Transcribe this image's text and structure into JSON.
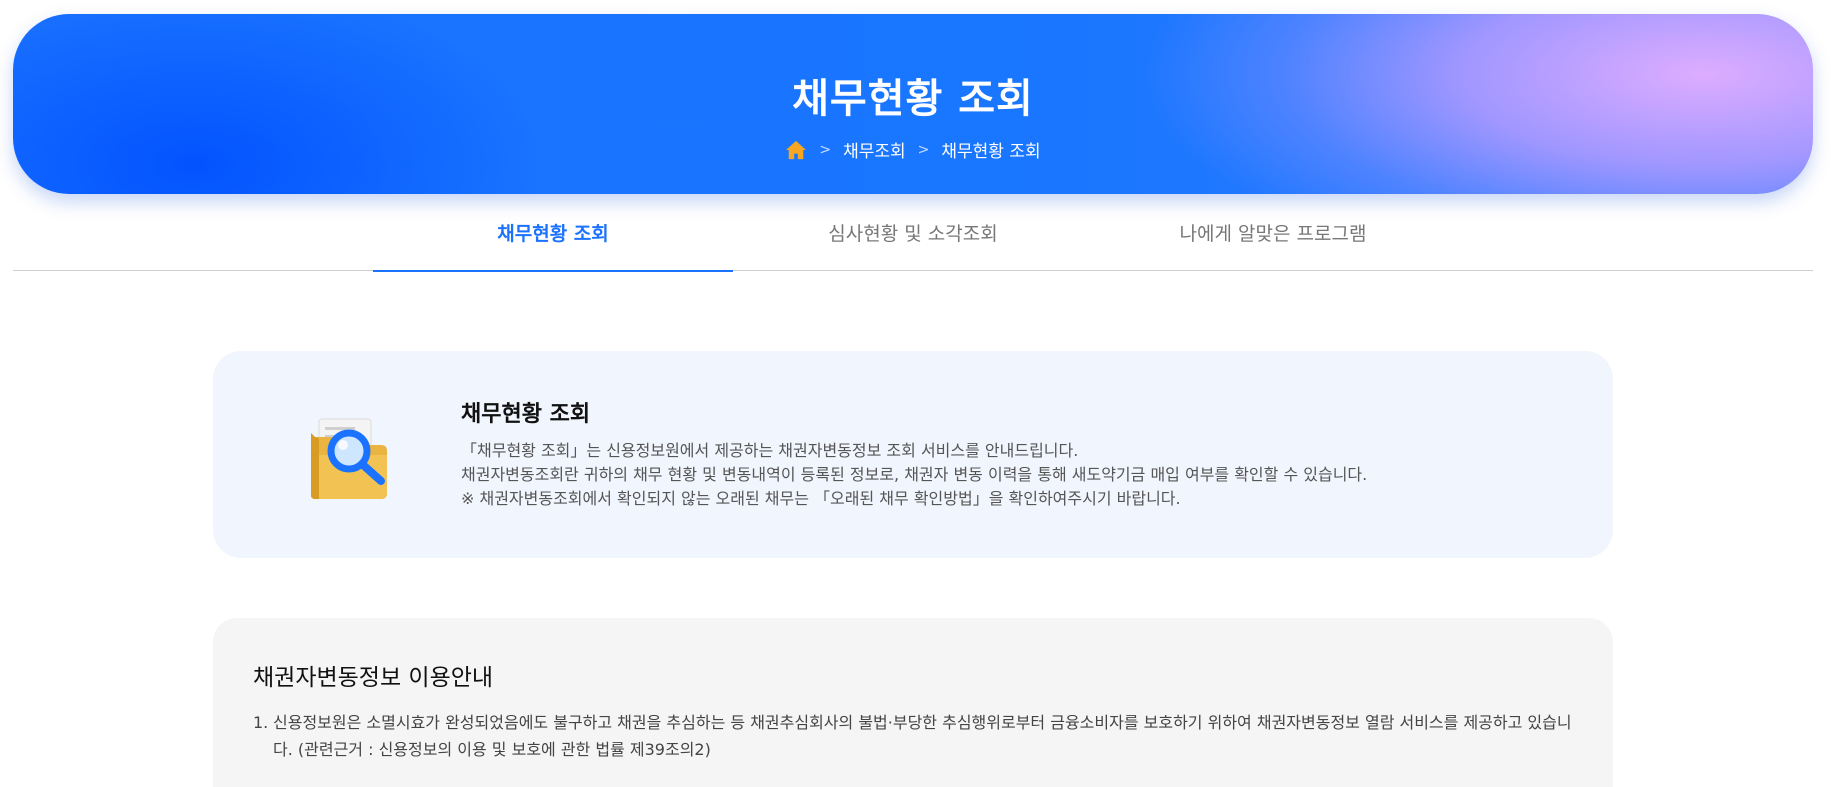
{
  "hero": {
    "title": "채무현황 조회",
    "breadcrumb": {
      "home_icon": "home-icon",
      "separator": ">",
      "items": [
        "채무조회",
        "채무현황 조회"
      ]
    }
  },
  "tabs": [
    {
      "label": "채무현황 조회",
      "active": true
    },
    {
      "label": "심사현황 및 소각조회",
      "active": false
    },
    {
      "label": "나에게 알맞은 프로그램",
      "active": false
    }
  ],
  "intro": {
    "icon": "folder-search-icon",
    "title": "채무현황 조회",
    "lines": [
      "「채무현황 조회」는 신용정보원에서 제공하는 채권자변동정보 조회 서비스를 안내드립니다.",
      "채권자변동조회란 귀하의 채무 현황 및 변동내역이 등록된 정보로, 채권자 변동 이력을 통해 새도약기금 매입 여부를 확인할 수 있습니다.",
      "※ 채권자변동조회에서 확인되지 않는 오래된 채무는 「오래된 채무 확인방법」을 확인하여주시기 바랍니다."
    ]
  },
  "guide": {
    "title": "채권자변동정보 이용안내",
    "items": [
      {
        "num": "1.",
        "text": "신용정보원은 소멸시효가 완성되었음에도 불구하고 채권을 추심하는 등 채권추심회사의 불법·부당한 추심행위로부터 금융소비자를 보호하기 위하여 채권자변동정보 열람 서비스를 제공하고 있습니다. (관련근거 : 신용정보의 이용 및 보호에 관한 법률 제39조의2)"
      }
    ]
  },
  "colors": {
    "accent": "#1a72ff",
    "home_icon": "#f5a623",
    "intro_bg": "#f1f5fd",
    "guide_bg": "#f5f5f5"
  }
}
